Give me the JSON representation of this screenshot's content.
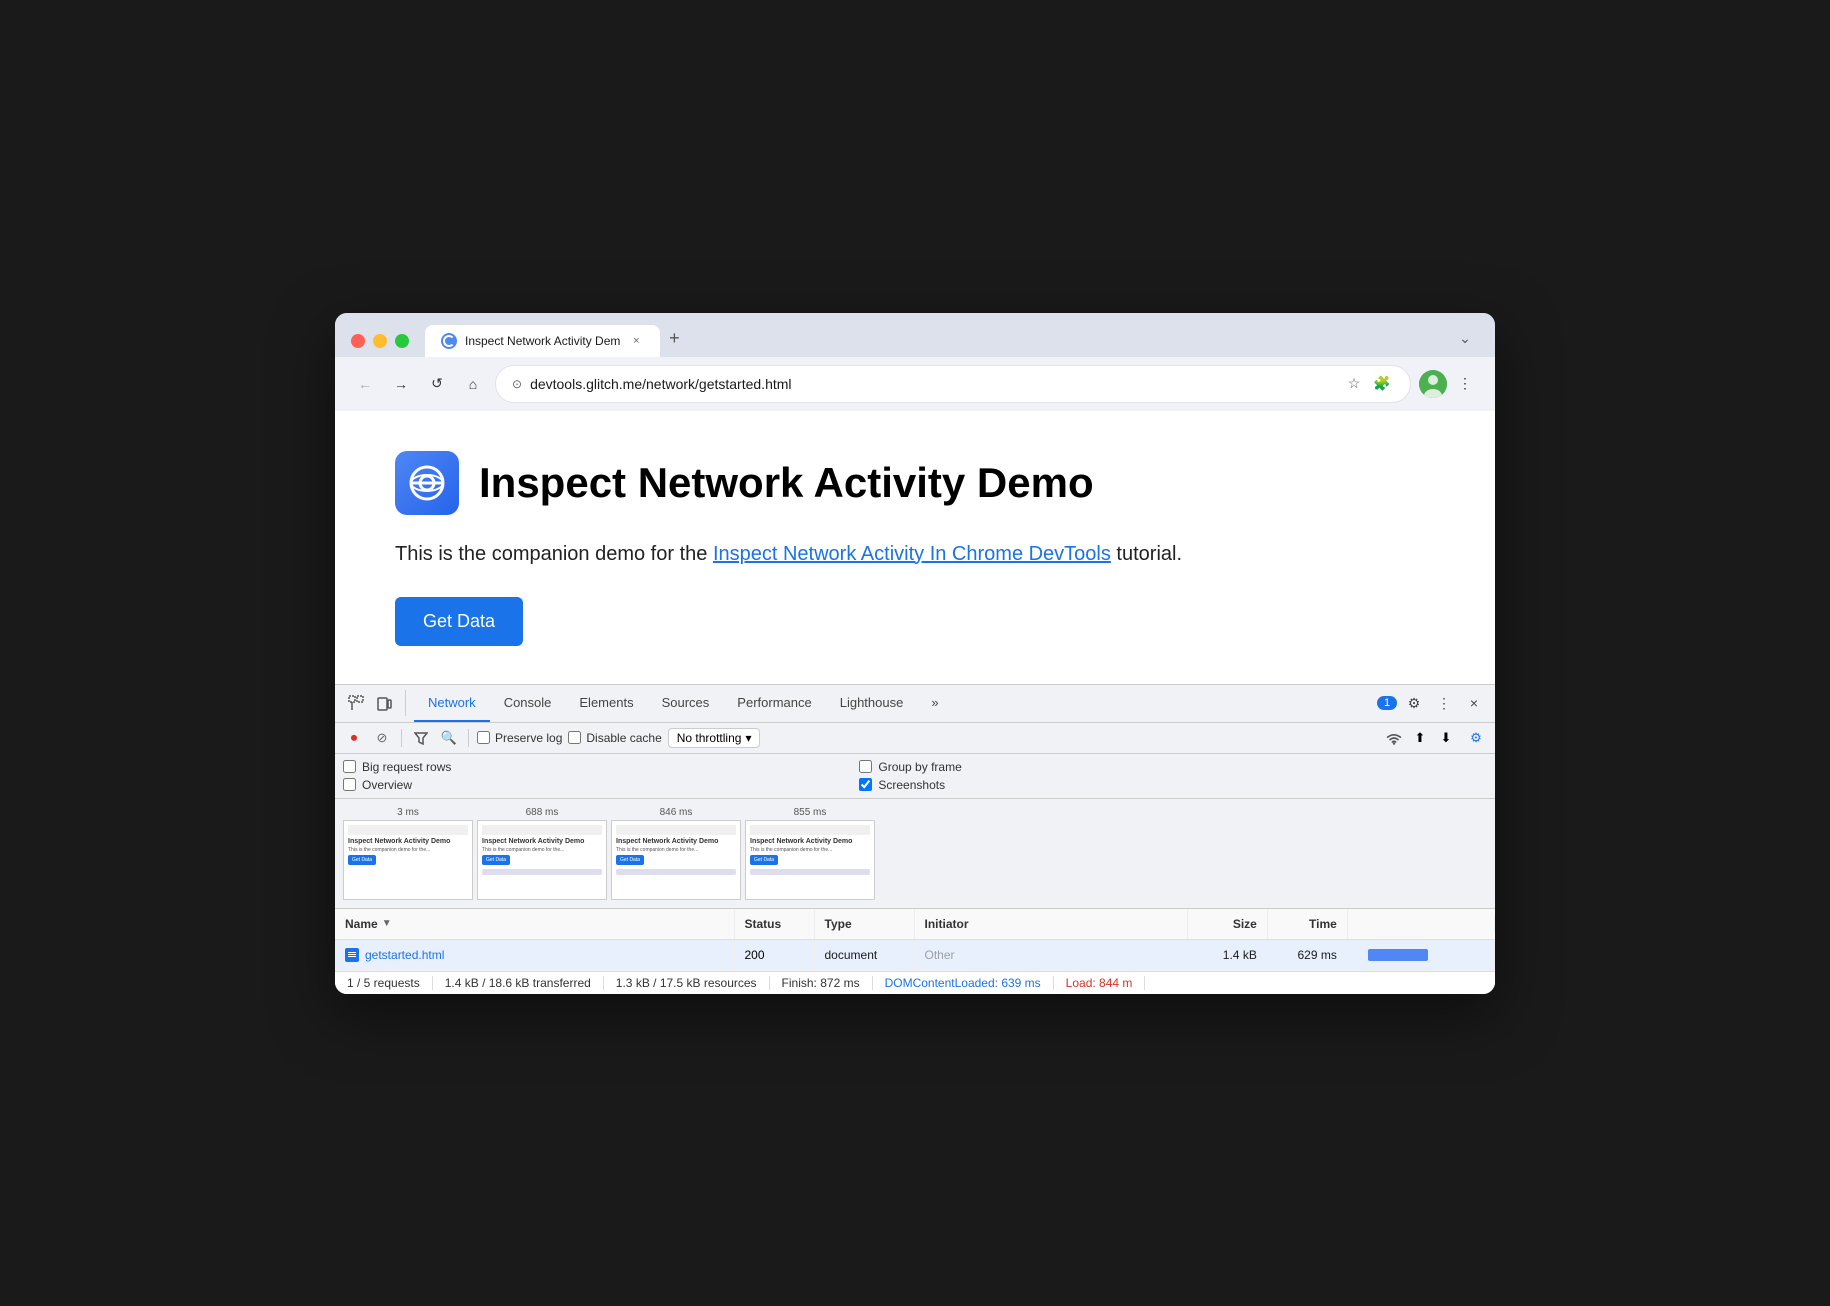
{
  "browser": {
    "tab_title": "Inspect Network Activity Dem",
    "tab_close": "×",
    "new_tab": "+",
    "expand_icon": "⌄",
    "back_disabled": true,
    "forward_disabled": true,
    "reload": "↺",
    "home": "⌂",
    "address": "devtools.glitch.me/network/getstarted.html",
    "bookmark": "☆",
    "extensions": "🧩",
    "menu": "⋮"
  },
  "page": {
    "title": "Inspect Network Activity Demo",
    "description_before": "This is the companion demo for the ",
    "link_text": "Inspect Network Activity In Chrome DevTools",
    "description_after": " tutorial.",
    "button_label": "Get Data"
  },
  "devtools": {
    "left_icons": [
      "⋮⋮",
      "⬜"
    ],
    "tabs": [
      "Network",
      "Console",
      "Elements",
      "Sources",
      "Performance",
      "Lighthouse",
      "»"
    ],
    "active_tab": "Network",
    "badge_count": "1",
    "settings_icon": "⚙",
    "more_icon": "⋮",
    "close_icon": "×"
  },
  "network_toolbar": {
    "record_icon": "⏺",
    "clear_icon": "🚫",
    "filter_icon": "⫸",
    "search_icon": "🔍",
    "preserve_log_label": "Preserve log",
    "disable_cache_label": "Disable cache",
    "throttling_label": "No throttling",
    "throttling_arrow": "▾",
    "wifi_icon": "⊙",
    "upload_icon": "⬆",
    "download_icon": "⬇",
    "settings_icon": "⚙"
  },
  "options": {
    "big_request_rows": "Big request rows",
    "overview": "Overview",
    "group_by_frame": "Group by frame",
    "screenshots": "Screenshots",
    "screenshots_checked": true,
    "big_request_rows_checked": false,
    "overview_checked": false,
    "group_by_frame_checked": false
  },
  "screenshots": [
    {
      "time": "3 ms",
      "label": "Inspect Network Activity Demo"
    },
    {
      "time": "688 ms",
      "label": "Inspect Network Activity Demo"
    },
    {
      "time": "846 ms",
      "label": "Inspect Network Activity Demo"
    },
    {
      "time": "855 ms",
      "label": "Inspect Network Activity Demo"
    }
  ],
  "table": {
    "headers": {
      "name": "Name",
      "status": "Status",
      "type": "Type",
      "initiator": "Initiator",
      "size": "Size",
      "time": "Time"
    },
    "rows": [
      {
        "name": "getstarted.html",
        "status": "200",
        "type": "document",
        "initiator": "Other",
        "size": "1.4 kB",
        "time": "629 ms"
      }
    ]
  },
  "status_bar": {
    "requests": "1 / 5 requests",
    "transferred": "1.4 kB / 18.6 kB transferred",
    "resources": "1.3 kB / 17.5 kB resources",
    "finish": "Finish: 872 ms",
    "dom_content_loaded": "DOMContentLoaded: 639 ms",
    "load": "Load: 844 m"
  }
}
